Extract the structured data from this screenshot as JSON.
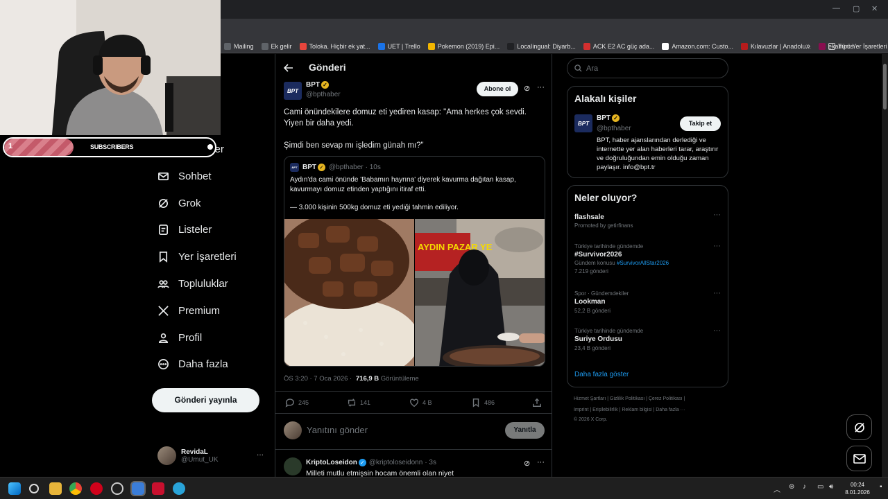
{
  "browser": {
    "bookmarks": [
      {
        "label": "Mailing",
        "color": "#5f6368"
      },
      {
        "label": "Ek gelir",
        "color": "#5f6368"
      },
      {
        "label": "Toloka. Hiçbir ek yat...",
        "color": "#e8453c"
      },
      {
        "label": "UET | Trello",
        "color": "#1a73e8"
      },
      {
        "label": "Pokemon (2019) Epi...",
        "color": "#f2b600"
      },
      {
        "label": "LocaIingual: Diyarb...",
        "color": "#202124"
      },
      {
        "label": "ACK E2 AC güç ada...",
        "color": "#d32f2f"
      },
      {
        "label": "Amazon.com: Custo...",
        "color": "#ffffff"
      },
      {
        "label": "Kılavuzlar | Anadolu...",
        "color": "#b71c1c"
      },
      {
        "label": "ekampüs",
        "color": "#880e4f"
      }
    ],
    "more_label": "»",
    "all_bookmarks": "Tüm Yer İşaretleri"
  },
  "stream_overlay": {
    "subscriber_count": "1",
    "subscriber_label": "SUBSCRIBERS",
    "progress": 0.33
  },
  "nav": {
    "items": [
      {
        "label": "Bildirimler",
        "icon": "bell-icon"
      },
      {
        "label": "Sohbet",
        "icon": "mail-icon"
      },
      {
        "label": "Grok",
        "icon": "grok-icon"
      },
      {
        "label": "Listeler",
        "icon": "list-icon"
      },
      {
        "label": "Yer İşaretleri",
        "icon": "bookmark-icon"
      },
      {
        "label": "Topluluklar",
        "icon": "communities-icon"
      },
      {
        "label": "Premium",
        "icon": "x-logo-icon"
      },
      {
        "label": "Profil",
        "icon": "person-icon"
      },
      {
        "label": "Daha fazla",
        "icon": "more-circle-icon"
      }
    ],
    "post_button": "Gönderi yayınla",
    "user_name": "RevidaL",
    "user_handle": "@Umut_UK",
    "user_more": "···"
  },
  "post": {
    "header_title": "Gönderi",
    "author_name": "BPT",
    "author_handle": "@bpthaber",
    "logo_text": "BPT",
    "subscribe_label": "Abone ol",
    "text_line1": "Cami önündekilere domuz eti yediren kasap: \"Ama herkes çok sevdi.",
    "text_line2": "Yiyen bir daha yedi.",
    "text_line3": "Şimdi ben sevap mı işledim günah mı?\"",
    "quote": {
      "author_name": "BPT",
      "author_handle": "@bpthaber",
      "time": "· 10s",
      "line1": "Aydın'da cami önünde 'Babamın hayrına' diyerek kavurma dağıtan kasap,",
      "line2": "kavurmayı domuz etinden yaptığını itiraf etti.",
      "line3": "— 3.000 kişinin 500kg domuz eti yediği tahmin ediliyor.",
      "sign_text": "AYDIN PAZAR YE"
    },
    "meta_time": "ÖS 3:20 · 7 Oca 2026 ·",
    "meta_views": "716,9 B",
    "meta_views_label": "Görüntüleme",
    "stats": {
      "replies": "245",
      "reposts": "141",
      "likes": "4 B",
      "bookmarks": "486"
    },
    "reply_placeholder": "Yanıtını gönder",
    "reply_button": "Yanıtla"
  },
  "next_post": {
    "author_name": "KriptoLoseidon",
    "author_handle": "@kriptoloseidonn",
    "time": "· 3s",
    "text": "Milleti mutlu etmişsin hocam önemli olan niyet"
  },
  "sidebar": {
    "search_placeholder": "Ara",
    "related_title": "Alakalı kişiler",
    "related_name": "BPT",
    "related_handle": "@bpthaber",
    "follow_label": "Takip et",
    "related_bio": "BPT, haber ajanslarından derlediği ve internette yer alan haberleri tarar, araştırır ve doğruluğundan emin olduğu zaman paylaşır. info@bpt.tr",
    "trends_title": "Neler oluyor?",
    "trends": [
      {
        "context": "",
        "title": "flashsale",
        "sub": "Promoted by getirfinans",
        "sub_link": "",
        "count": ""
      },
      {
        "context": "Türkiye tarihinde gündemde",
        "title": "#Survivor2026",
        "sub": "Gündem konusu",
        "sub_link": "#SurvivorAllStar2026",
        "count": "7.219 gönderi"
      },
      {
        "context": "Spor · Gündemdekiler",
        "title": "Lookman",
        "sub": "",
        "sub_link": "",
        "count": "52,2 B gönderi"
      },
      {
        "context": "Türkiye tarihinde gündemde",
        "title": "Suriye Ordusu",
        "sub": "",
        "sub_link": "",
        "count": "23,4 B gönderi"
      }
    ],
    "show_more": "Daha fazla göster",
    "footer_row1": "Hizmet Şartları  |  Gizlilik Politikası  |  Çerez Politikası  |",
    "footer_row2": "Imprint  |  Erişilebilirlik  |  Reklam bilgisi  |  Daha fazla ···",
    "footer_row3": "© 2026 X Corp."
  },
  "taskbar": {
    "time": "00:24",
    "date": "8.01.2026"
  }
}
